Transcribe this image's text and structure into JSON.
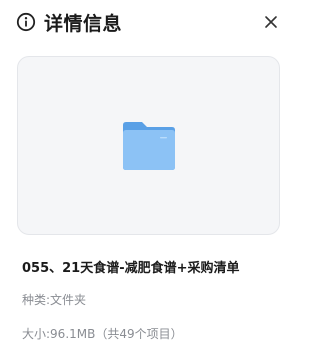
{
  "header": {
    "icon": "info-circle-icon",
    "title": "详情信息",
    "close_icon": "close-icon"
  },
  "preview": {
    "icon": "folder-icon",
    "folder_color": "#6aaff0"
  },
  "details": {
    "file_name": "055、21天食谱-减肥食谱+采购清单",
    "type_label": "种类:",
    "type_value": "文件夹",
    "size_label": "大小:",
    "size_value": "96.1MB（共49个项目）"
  }
}
